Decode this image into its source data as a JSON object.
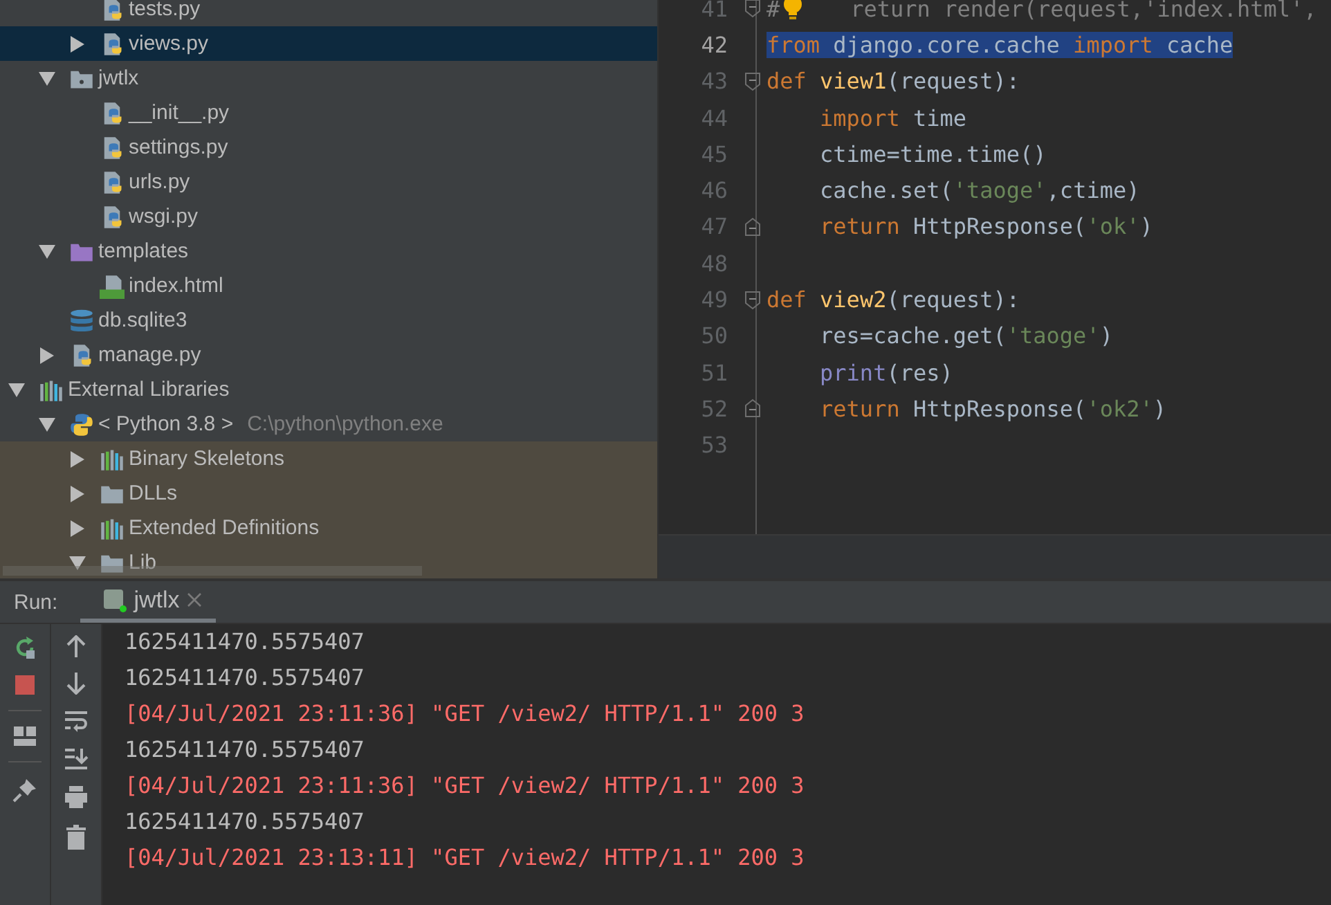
{
  "project_tree": {
    "scrolled_branch": [
      {
        "label": "tests.py",
        "kind": "python",
        "selected": false
      },
      {
        "label": "views.py",
        "kind": "python",
        "expanded": false,
        "selected": true
      }
    ],
    "items": [
      {
        "label": "jwtlx",
        "kind": "module-folder",
        "expanded": true,
        "selected": false,
        "children": [
          {
            "label": "__init__.py",
            "kind": "python",
            "selected": false
          },
          {
            "label": "settings.py",
            "kind": "python",
            "selected": false
          },
          {
            "label": "urls.py",
            "kind": "python",
            "selected": false
          },
          {
            "label": "wsgi.py",
            "kind": "python",
            "selected": false
          }
        ]
      },
      {
        "label": "templates",
        "kind": "template-folder",
        "expanded": true,
        "selected": false,
        "children": [
          {
            "label": "index.html",
            "kind": "html",
            "selected": false
          }
        ]
      },
      {
        "label": "db.sqlite3",
        "kind": "database",
        "selected": false
      },
      {
        "label": "manage.py",
        "kind": "python",
        "expanded": false,
        "selected": false
      }
    ],
    "roots": [
      {
        "label": "External Libraries",
        "kind": "library",
        "expanded": true,
        "selected": false,
        "children": [
          {
            "label": "< Python 3.8 >",
            "detail": "C:\\python\\python.exe",
            "kind": "python-sdk",
            "expanded": true,
            "selected": false,
            "children": [
              {
                "label": "Binary Skeletons",
                "kind": "library",
                "expanded": false,
                "selected": false,
                "highlighted": true
              },
              {
                "label": "DLLs",
                "kind": "folder",
                "expanded": false,
                "selected": false,
                "highlighted": true
              },
              {
                "label": "Extended Definitions",
                "kind": "library",
                "expanded": false,
                "selected": false,
                "highlighted": true
              },
              {
                "label": "Lib",
                "kind": "folder",
                "expanded": true,
                "selected": false,
                "highlighted": true
              }
            ]
          }
        ]
      }
    ]
  },
  "editor": {
    "lines": [
      {
        "number": "41",
        "kind": "fold-start",
        "bulb": true,
        "selected": false,
        "tokens": [
          {
            "text": "#",
            "kind": "comment"
          },
          {
            "text": "return render(request,'index.html',",
            "kind": "comment"
          }
        ]
      },
      {
        "number": "42",
        "kind": "code",
        "selected": true,
        "tokens": [
          {
            "text": "from",
            "kind": "keyword"
          },
          {
            "text": " django.core.cache",
            "kind": "plain"
          },
          {
            "text": " import",
            "kind": "keyword"
          },
          {
            "text": " cache",
            "kind": "plain"
          }
        ]
      },
      {
        "number": "43",
        "kind": "fold-start",
        "selected": false,
        "tokens": [
          {
            "text": "def",
            "kind": "keyword"
          },
          {
            "text": " view1",
            "kind": "function"
          },
          {
            "text": "(request):",
            "kind": "plain"
          }
        ]
      },
      {
        "number": "44",
        "kind": "code",
        "selected": false,
        "tokens": [
          {
            "text": "    import",
            "kind": "keyword"
          },
          {
            "text": " time",
            "kind": "plain"
          }
        ]
      },
      {
        "number": "45",
        "kind": "code",
        "selected": false,
        "tokens": [
          {
            "text": "    ctime=time.time()",
            "kind": "plain"
          }
        ]
      },
      {
        "number": "46",
        "kind": "code",
        "selected": false,
        "tokens": [
          {
            "text": "    cache.set(",
            "kind": "plain"
          },
          {
            "text": "'taoge'",
            "kind": "string"
          },
          {
            "text": ",ctime)",
            "kind": "plain"
          }
        ]
      },
      {
        "number": "47",
        "kind": "fold-end",
        "selected": false,
        "tokens": [
          {
            "text": "    return",
            "kind": "keyword"
          },
          {
            "text": " HttpResponse(",
            "kind": "plain"
          },
          {
            "text": "'ok'",
            "kind": "string"
          },
          {
            "text": ")",
            "kind": "plain"
          }
        ]
      },
      {
        "number": "48",
        "kind": "code",
        "selected": false
      },
      {
        "number": "49",
        "kind": "fold-start",
        "selected": false,
        "tokens": [
          {
            "text": "def",
            "kind": "keyword"
          },
          {
            "text": " view2",
            "kind": "function"
          },
          {
            "text": "(request):",
            "kind": "plain"
          }
        ]
      },
      {
        "number": "50",
        "kind": "code",
        "selected": false,
        "tokens": [
          {
            "text": "    res=cache.get(",
            "kind": "plain"
          },
          {
            "text": "'taoge'",
            "kind": "string"
          },
          {
            "text": ")",
            "kind": "plain"
          }
        ]
      },
      {
        "number": "51",
        "kind": "code",
        "selected": false,
        "tokens": [
          {
            "text": "    print",
            "kind": "builtin"
          },
          {
            "text": "(res)",
            "kind": "plain"
          }
        ]
      },
      {
        "number": "52",
        "kind": "fold-end",
        "selected": false,
        "tokens": [
          {
            "text": "    return",
            "kind": "keyword"
          },
          {
            "text": " HttpResponse(",
            "kind": "plain"
          },
          {
            "text": "'ok2'",
            "kind": "string"
          },
          {
            "text": ")",
            "kind": "plain"
          }
        ]
      },
      {
        "number": "53",
        "kind": "code",
        "selected": false
      }
    ]
  },
  "run_panel": {
    "title": "Run:",
    "tabs": [
      {
        "label": "jwtlx",
        "selected": true
      }
    ],
    "console": [
      {
        "text": "1625411470.5575407",
        "kind": "stdout"
      },
      {
        "text": "1625411470.5575407",
        "kind": "stdout"
      },
      {
        "text": "[04/Jul/2021 23:11:36] \"GET /view2/ HTTP/1.1\" 200 3",
        "kind": "stderr"
      },
      {
        "text": "1625411470.5575407",
        "kind": "stdout"
      },
      {
        "text": "[04/Jul/2021 23:11:36] \"GET /view2/ HTTP/1.1\" 200 3",
        "kind": "stderr"
      },
      {
        "text": "1625411470.5575407",
        "kind": "stdout"
      },
      {
        "text": "[04/Jul/2021 23:13:11] \"GET /view2/ HTTP/1.1\" 200 3",
        "kind": "stderr"
      }
    ]
  }
}
